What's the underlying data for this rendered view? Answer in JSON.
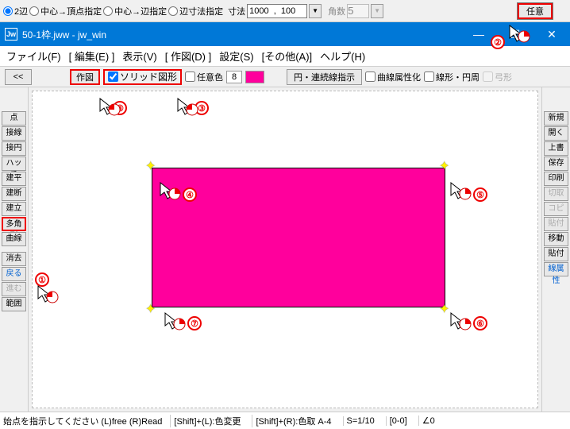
{
  "top_opts": {
    "radios": [
      "2辺",
      "中心→頂点指定",
      "中心→辺指定",
      "辺寸法指定"
    ],
    "selected": 0,
    "dim_label": "寸法",
    "dim_value": "1000  ,  100",
    "kakusu_label": "角数",
    "kakusu_value": "5",
    "nini_btn": "任意"
  },
  "titlebar": {
    "icon": "Jw",
    "text": "50-1枠.jww - jw_win"
  },
  "menu": [
    "ファイル(F)",
    "[ 編集(E) ]",
    "表示(V)",
    "[ 作図(D) ]",
    "設定(S)",
    "[その他(A)]",
    "ヘルプ(H)"
  ],
  "toolbar2": {
    "back": "<<",
    "sakuzu": "作図",
    "solid_chk": "ソリッド図形",
    "nini_color_chk": "任意色",
    "color_idx": "8",
    "en_renzoku": "円・連続線指示",
    "kyokusen_zokusei": "曲線属性化",
    "senkei_enshuu": "線形・円周",
    "kyuukei": "弓形"
  },
  "left_tools": [
    "点",
    "接線",
    "接円",
    "ハッチ",
    "建平",
    "建断",
    "建立",
    "多角形",
    "曲線",
    "",
    "消去",
    "戻る",
    "進む",
    "範囲"
  ],
  "right_tools": [
    "新規",
    "開く",
    "上書",
    "保存",
    "印刷",
    "切取",
    "コピー",
    "貼付",
    "移動",
    "貼付",
    "線属性"
  ],
  "status": {
    "msg": "始点を指示してください  (L)free  (R)Read",
    "s1": "[Shift]+(L):色変更",
    "s2": "[Shift]+(R):色取 A-4",
    "s3": "S=1/10",
    "s4": "[0-0]",
    "s5": "∠0"
  },
  "annotations": [
    "①",
    "②",
    "③",
    "④",
    "⑤",
    "⑥",
    "⑦",
    "⑧"
  ]
}
